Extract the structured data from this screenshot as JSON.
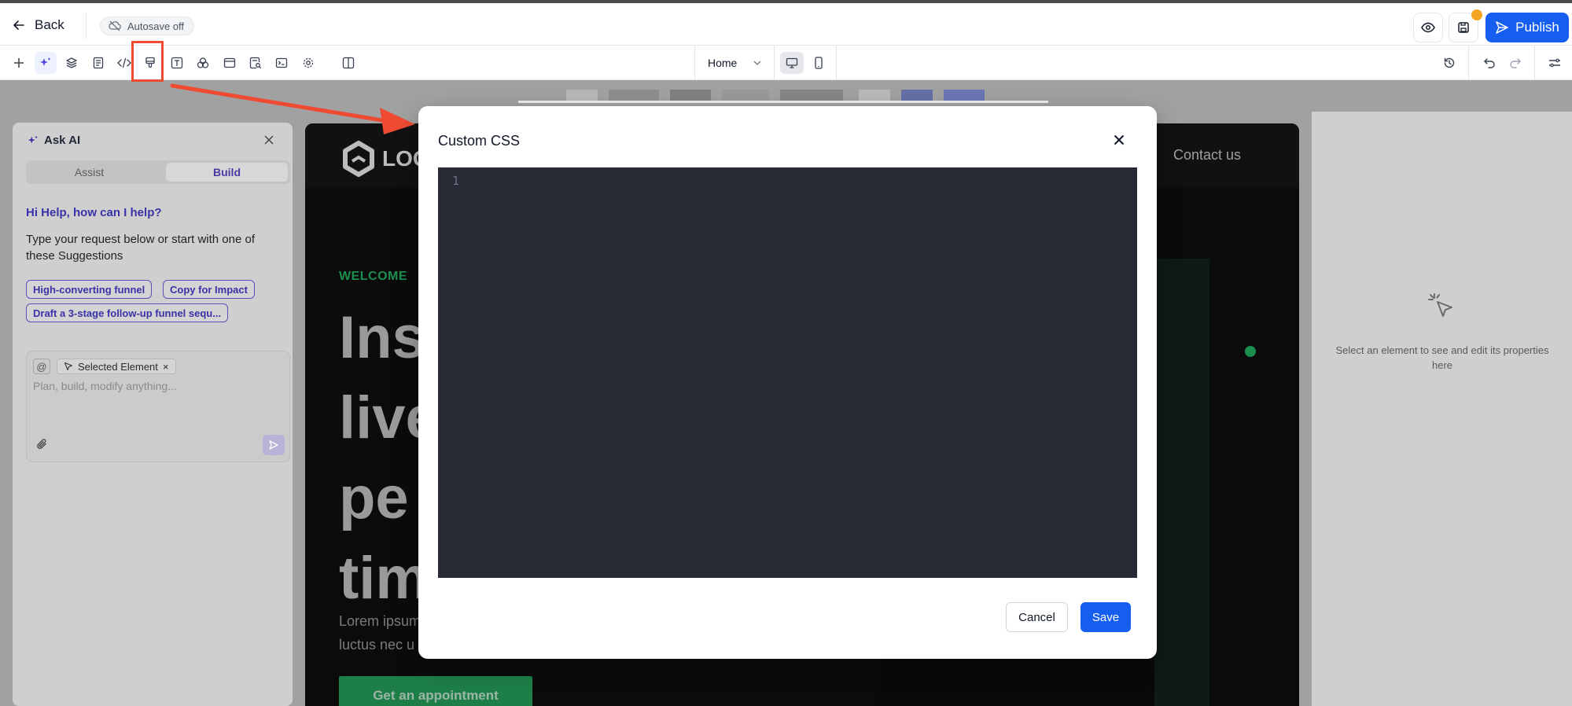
{
  "topbar": {
    "back_label": "Back",
    "autosave_label": "Autosave off",
    "publish_label": "Publish"
  },
  "toolbar": {
    "tools": [
      "add-icon",
      "ai-sparkle-icon",
      "layers-icon",
      "pages-icon",
      "code-icon",
      "custom-css-icon",
      "text-icon",
      "elements-icon",
      "section-icon",
      "forms-icon",
      "scripts-icon",
      "settings-icon",
      "panel-toggle-icon"
    ],
    "page_select_value": "Home"
  },
  "ai_panel": {
    "title": "Ask AI",
    "tabs": [
      {
        "label": "Assist"
      },
      {
        "label": "Build"
      }
    ],
    "active_tab": "Build",
    "greeting": "Hi Help, how can I help?",
    "intro": "Type your request below or start with one of these Suggestions",
    "suggestions": [
      "High-converting funnel",
      "Copy for Impact",
      "Draft a 3-stage follow-up funnel sequ..."
    ],
    "composer": {
      "at_symbol": "@",
      "selected_element_label": "Selected Element",
      "selected_element_remove": "×",
      "placeholder": "Plan, build, modify anything..."
    }
  },
  "site_preview": {
    "logo_text": "LOG",
    "nav_contact": "Contact us",
    "welcome": "WELCOME",
    "hero_lines": [
      "Ins",
      "live",
      "pe",
      "tim"
    ],
    "lorem_lines": [
      "Lorem ipsum",
      "luctus nec u"
    ],
    "cta_label": "Get an appointment",
    "accent_color": "#1c8e4d"
  },
  "properties_panel": {
    "empty_text": "Select an element to see and edit its properties here"
  },
  "modal": {
    "title": "Custom CSS",
    "line_numbers": [
      "1"
    ],
    "editor_value": "",
    "cancel_label": "Cancel",
    "save_label": "Save"
  },
  "colors": {
    "primary": "#155eef",
    "annotation": "#ef4b33",
    "editor_bg": "#282a36"
  }
}
